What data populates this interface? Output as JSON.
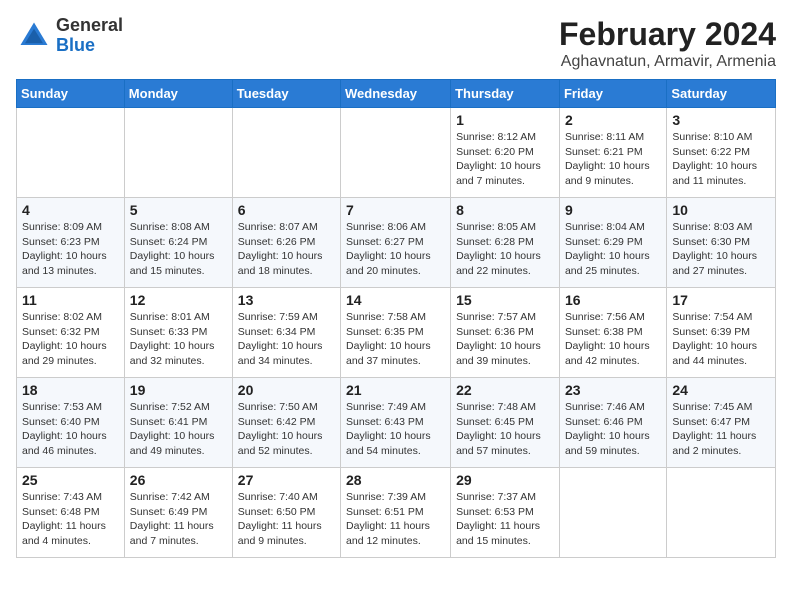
{
  "header": {
    "logo_general": "General",
    "logo_blue": "Blue",
    "month_title": "February 2024",
    "location": "Aghavnatun, Armavir, Armenia"
  },
  "days_of_week": [
    "Sunday",
    "Monday",
    "Tuesday",
    "Wednesday",
    "Thursday",
    "Friday",
    "Saturday"
  ],
  "weeks": [
    [
      {
        "day": "",
        "info": ""
      },
      {
        "day": "",
        "info": ""
      },
      {
        "day": "",
        "info": ""
      },
      {
        "day": "",
        "info": ""
      },
      {
        "day": "1",
        "info": "Sunrise: 8:12 AM\nSunset: 6:20 PM\nDaylight: 10 hours\nand 7 minutes."
      },
      {
        "day": "2",
        "info": "Sunrise: 8:11 AM\nSunset: 6:21 PM\nDaylight: 10 hours\nand 9 minutes."
      },
      {
        "day": "3",
        "info": "Sunrise: 8:10 AM\nSunset: 6:22 PM\nDaylight: 10 hours\nand 11 minutes."
      }
    ],
    [
      {
        "day": "4",
        "info": "Sunrise: 8:09 AM\nSunset: 6:23 PM\nDaylight: 10 hours\nand 13 minutes."
      },
      {
        "day": "5",
        "info": "Sunrise: 8:08 AM\nSunset: 6:24 PM\nDaylight: 10 hours\nand 15 minutes."
      },
      {
        "day": "6",
        "info": "Sunrise: 8:07 AM\nSunset: 6:26 PM\nDaylight: 10 hours\nand 18 minutes."
      },
      {
        "day": "7",
        "info": "Sunrise: 8:06 AM\nSunset: 6:27 PM\nDaylight: 10 hours\nand 20 minutes."
      },
      {
        "day": "8",
        "info": "Sunrise: 8:05 AM\nSunset: 6:28 PM\nDaylight: 10 hours\nand 22 minutes."
      },
      {
        "day": "9",
        "info": "Sunrise: 8:04 AM\nSunset: 6:29 PM\nDaylight: 10 hours\nand 25 minutes."
      },
      {
        "day": "10",
        "info": "Sunrise: 8:03 AM\nSunset: 6:30 PM\nDaylight: 10 hours\nand 27 minutes."
      }
    ],
    [
      {
        "day": "11",
        "info": "Sunrise: 8:02 AM\nSunset: 6:32 PM\nDaylight: 10 hours\nand 29 minutes."
      },
      {
        "day": "12",
        "info": "Sunrise: 8:01 AM\nSunset: 6:33 PM\nDaylight: 10 hours\nand 32 minutes."
      },
      {
        "day": "13",
        "info": "Sunrise: 7:59 AM\nSunset: 6:34 PM\nDaylight: 10 hours\nand 34 minutes."
      },
      {
        "day": "14",
        "info": "Sunrise: 7:58 AM\nSunset: 6:35 PM\nDaylight: 10 hours\nand 37 minutes."
      },
      {
        "day": "15",
        "info": "Sunrise: 7:57 AM\nSunset: 6:36 PM\nDaylight: 10 hours\nand 39 minutes."
      },
      {
        "day": "16",
        "info": "Sunrise: 7:56 AM\nSunset: 6:38 PM\nDaylight: 10 hours\nand 42 minutes."
      },
      {
        "day": "17",
        "info": "Sunrise: 7:54 AM\nSunset: 6:39 PM\nDaylight: 10 hours\nand 44 minutes."
      }
    ],
    [
      {
        "day": "18",
        "info": "Sunrise: 7:53 AM\nSunset: 6:40 PM\nDaylight: 10 hours\nand 46 minutes."
      },
      {
        "day": "19",
        "info": "Sunrise: 7:52 AM\nSunset: 6:41 PM\nDaylight: 10 hours\nand 49 minutes."
      },
      {
        "day": "20",
        "info": "Sunrise: 7:50 AM\nSunset: 6:42 PM\nDaylight: 10 hours\nand 52 minutes."
      },
      {
        "day": "21",
        "info": "Sunrise: 7:49 AM\nSunset: 6:43 PM\nDaylight: 10 hours\nand 54 minutes."
      },
      {
        "day": "22",
        "info": "Sunrise: 7:48 AM\nSunset: 6:45 PM\nDaylight: 10 hours\nand 57 minutes."
      },
      {
        "day": "23",
        "info": "Sunrise: 7:46 AM\nSunset: 6:46 PM\nDaylight: 10 hours\nand 59 minutes."
      },
      {
        "day": "24",
        "info": "Sunrise: 7:45 AM\nSunset: 6:47 PM\nDaylight: 11 hours\nand 2 minutes."
      }
    ],
    [
      {
        "day": "25",
        "info": "Sunrise: 7:43 AM\nSunset: 6:48 PM\nDaylight: 11 hours\nand 4 minutes."
      },
      {
        "day": "26",
        "info": "Sunrise: 7:42 AM\nSunset: 6:49 PM\nDaylight: 11 hours\nand 7 minutes."
      },
      {
        "day": "27",
        "info": "Sunrise: 7:40 AM\nSunset: 6:50 PM\nDaylight: 11 hours\nand 9 minutes."
      },
      {
        "day": "28",
        "info": "Sunrise: 7:39 AM\nSunset: 6:51 PM\nDaylight: 11 hours\nand 12 minutes."
      },
      {
        "day": "29",
        "info": "Sunrise: 7:37 AM\nSunset: 6:53 PM\nDaylight: 11 hours\nand 15 minutes."
      },
      {
        "day": "",
        "info": ""
      },
      {
        "day": "",
        "info": ""
      }
    ]
  ]
}
